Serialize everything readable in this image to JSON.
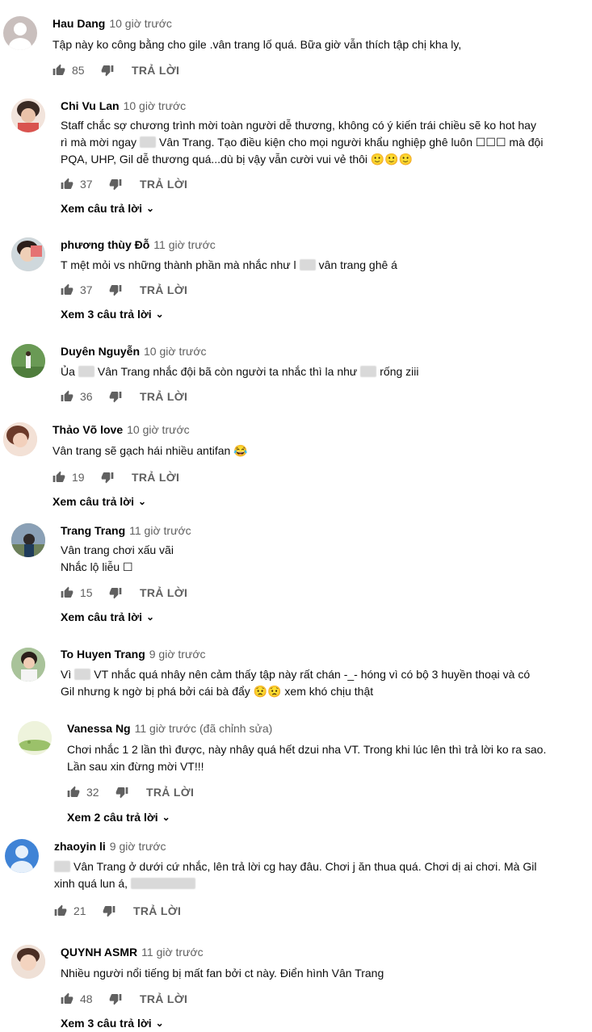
{
  "reply_label": "TRẢ LỜI",
  "comments": [
    {
      "author": "Hau Dang",
      "time": "10 giờ trước",
      "text": "Tập này ko công bằng cho gile .vân trang lố quá. Bữa giờ vẫn thích tập chị kha ly,",
      "likes": "85"
    },
    {
      "author": "Chi Vu Lan",
      "time": "10 giờ trước",
      "text_1": "Staff chắc sợ chương trình mời toàn người dễ thương, không có ý kiến trái chiều sẽ ko hot hay",
      "text_2a": "rì mà mời ngay",
      "text_2b": "Vân Trang. Tạo điều kiện cho mọi người khẩu nghiệp ghê luôn ☐☐☐ mà đội",
      "text_3": "PQA, UHP, Gil dễ thương quá...dù bị vậy vẫn cười vui vẻ thôi 🙂🙂🙂",
      "likes": "37",
      "view_replies": "Xem câu trả lời"
    },
    {
      "author": "phương thùy Đỗ",
      "time": "11 giờ trước",
      "text_a": "T mệt mỏi vs những thành phần mà nhắc như l",
      "text_b": "vân trang ghê á",
      "likes": "37",
      "view_replies": "Xem 3 câu trả lời"
    },
    {
      "author": "Duyên Nguyễn",
      "time": "10 giờ trước",
      "text_a": "Ủa",
      "text_b": "Vân Trang nhắc đội bã còn người ta nhắc thì la như",
      "text_c": "rống ziii",
      "likes": "36"
    },
    {
      "author": "Thảo Võ love",
      "time": "10 giờ trước",
      "text": "Vân trang sẽ gạch hái nhiều antifan 😂",
      "likes": "19",
      "view_replies": "Xem câu trả lời"
    },
    {
      "author": "Trang Trang",
      "time": "11 giờ trước",
      "text_1": "Vân trang chơi xấu vãi",
      "text_2": "Nhắc lộ liễu ☐",
      "likes": "15",
      "view_replies": "Xem câu trả lời"
    },
    {
      "author": "To Huyen Trang",
      "time": "9 giờ trước",
      "text_1a": "Vì",
      "text_1b": "VT nhắc quá nhây nên cảm thấy tập này rất chán -_- hóng vì có bộ 3 huyền thoại và có",
      "text_2": "Gil nhưng k ngờ bị phá bởi cái bà đẩy 😟😟 xem khó chịu thật"
    },
    {
      "author": "Vanessa Ng",
      "time": "11 giờ trước (đã chỉnh sửa)",
      "text_1": "Chơi nhắc 1 2 lần thì được, này nhây quá hết dzui nha VT. Trong khi lúc lên thì trả lời ko ra sao.",
      "text_2": "Lần sau xin đừng mời VT!!!",
      "likes": "32",
      "view_replies": "Xem 2 câu trả lời"
    },
    {
      "author": "zhaoyin li",
      "time": "9 giờ trước",
      "text_1": "Vân Trang ở dưới cứ nhắc, lên trả lời cg hay đâu. Chơi j ăn thua quá. Chơi dị ai chơi. Mà Gil",
      "text_2": "xinh quá lun á,",
      "likes": "21"
    },
    {
      "author": "QUYNH ASMR",
      "time": "11 giờ trước",
      "text": "Nhiều người nổi tiếng bị mất fan bởi ct này. Điển hình Vân Trang",
      "likes": "48",
      "view_replies": "Xem 3 câu trả lời"
    }
  ]
}
